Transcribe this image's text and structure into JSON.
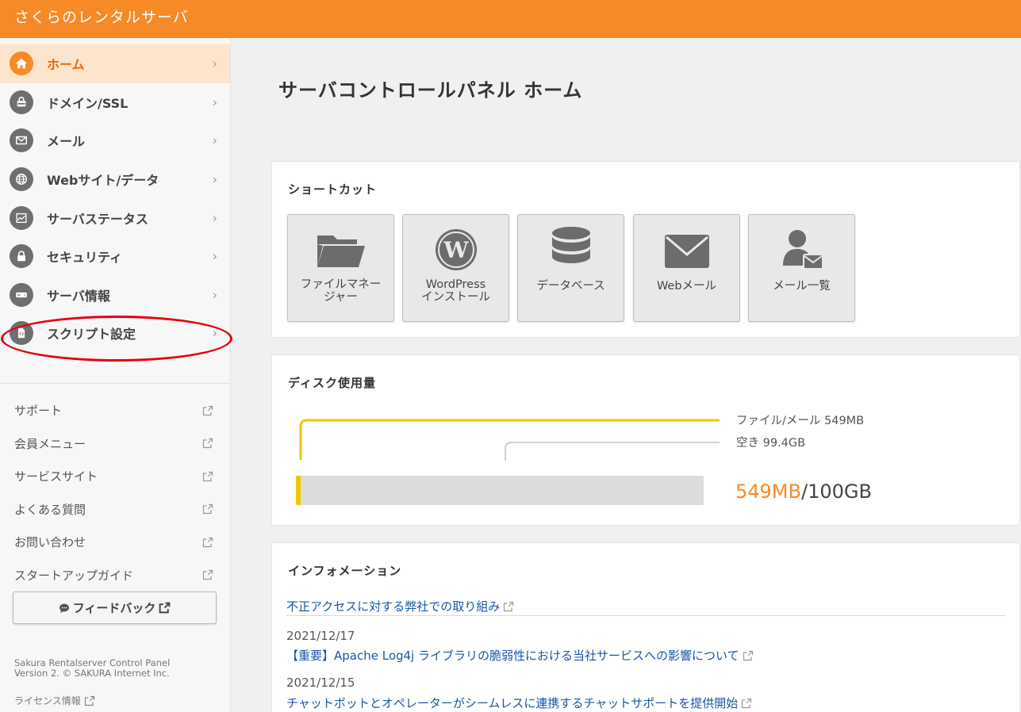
{
  "app": {
    "title": "さくらのレンタルサーバ"
  },
  "sidebar": {
    "items": [
      {
        "label": "ホーム",
        "icon": "home-icon",
        "active": true
      },
      {
        "label": "ドメイン/SSL",
        "icon": "domain-lock-icon"
      },
      {
        "label": "メール",
        "icon": "mail-icon"
      },
      {
        "label": "Webサイト/データ",
        "icon": "globe-icon"
      },
      {
        "label": "サーバステータス",
        "icon": "chart-icon"
      },
      {
        "label": "セキュリティ",
        "icon": "lock-icon"
      },
      {
        "label": "サーバ情報",
        "icon": "server-icon"
      },
      {
        "label": "スクリプト設定",
        "icon": "script-file-icon"
      }
    ],
    "chevron": "›",
    "links": [
      {
        "label": "サポート"
      },
      {
        "label": "会員メニュー"
      },
      {
        "label": "サービスサイト"
      },
      {
        "label": "よくある質問"
      },
      {
        "label": "お問い合わせ"
      },
      {
        "label": "スタートアップガイド"
      }
    ],
    "feedback_label": "フィードバック",
    "footer_line1": "Sakura Rentalserver Control Panel",
    "footer_line2": "Version 2. © SAKURA Internet Inc.",
    "license_label": "ライセンス情報"
  },
  "main": {
    "page_title": "サーバコントロールパネル ホーム",
    "shortcuts": {
      "title": "ショートカット",
      "items": [
        {
          "label_line1": "ファイルマネー",
          "label_line2": "ジャー",
          "icon": "folder-icon"
        },
        {
          "label_line1": "WordPress",
          "label_line2": "インストール",
          "icon": "wordpress-icon"
        },
        {
          "label_line1": "データベース",
          "label_line2": "",
          "icon": "database-icon"
        },
        {
          "label_line1": "Webメール",
          "label_line2": "",
          "icon": "envelope-icon"
        },
        {
          "label_line1": "メール一覧",
          "label_line2": "",
          "icon": "user-mail-icon"
        }
      ]
    },
    "disk": {
      "title": "ディスク使用量",
      "legend_used": "ファイル/メール 549MB",
      "legend_free": "空き 99.4GB",
      "used_text": "549MB",
      "total_text": "/100GB",
      "used_fraction": 0.0055,
      "used_color": "#f2c400",
      "free_color": "#dcdcdc"
    },
    "info": {
      "title": "インフォメーション",
      "items": [
        {
          "date": "",
          "text": "不正アクセスに対する弊社での取り組み"
        },
        {
          "date": "2021/12/17",
          "text": "【重要】Apache Log4j ライブラリの脆弱性における当社サービスへの影響について"
        },
        {
          "date": "2021/12/15",
          "text": "チャットボットとオペレーターがシームレスに連携するチャットサポートを提供開始"
        }
      ]
    }
  },
  "colors": {
    "accent": "#f68a26",
    "highlight": "#e60012",
    "link": "#1a56a4"
  }
}
